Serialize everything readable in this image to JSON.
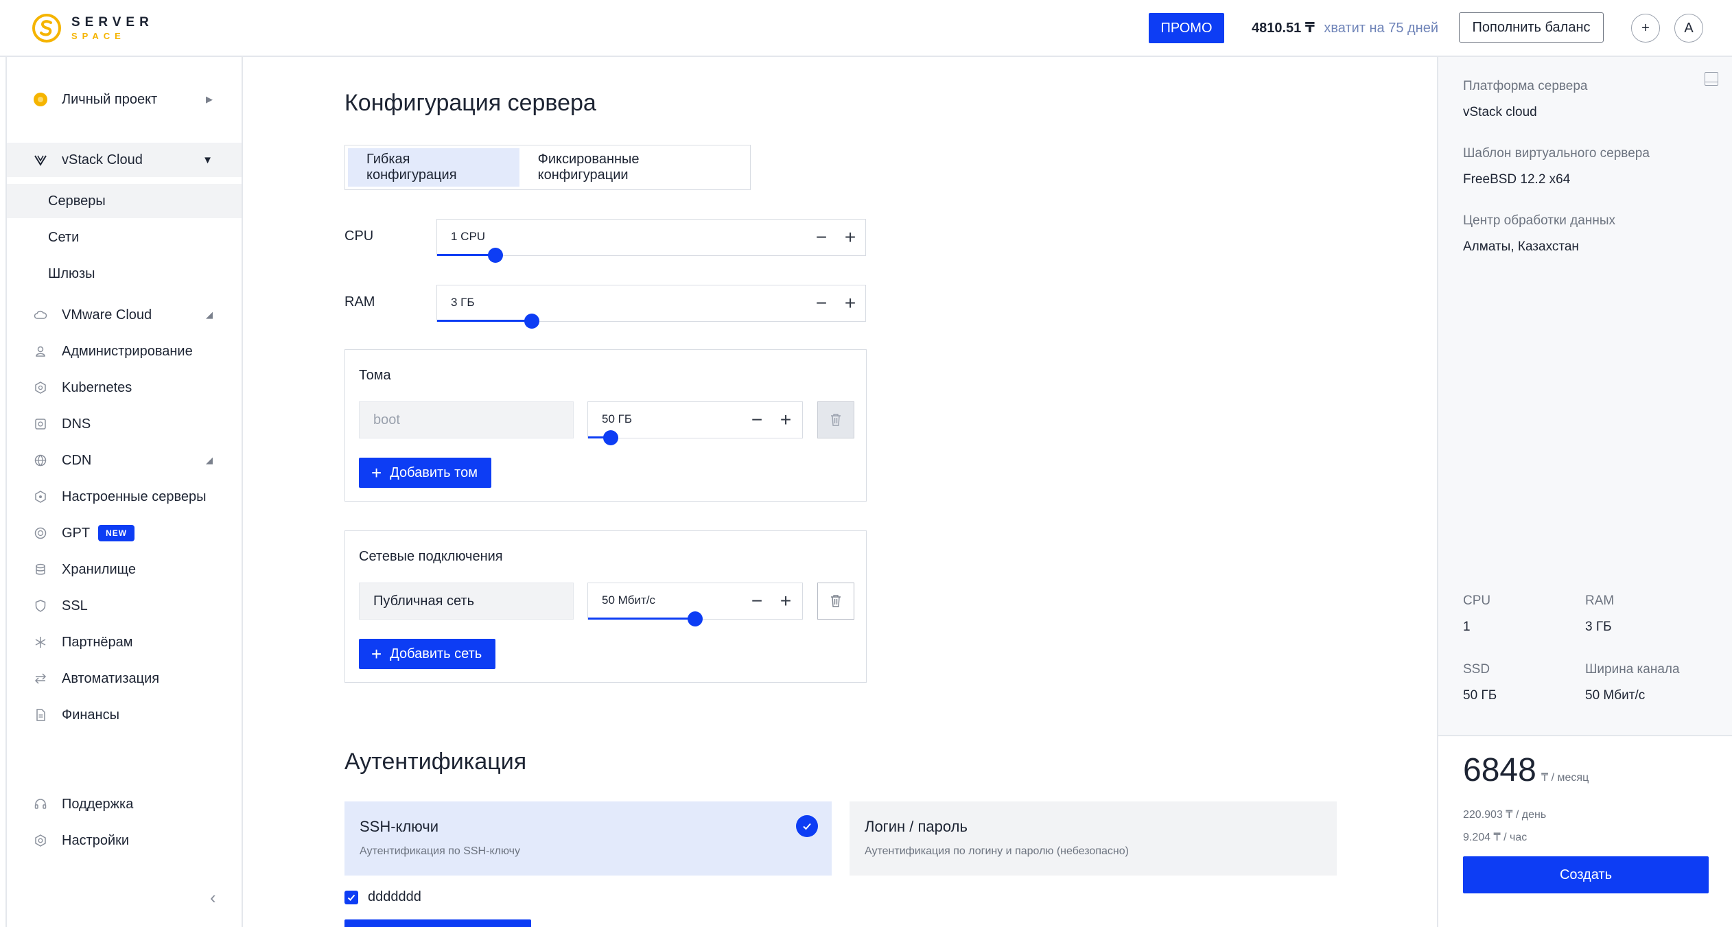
{
  "header": {
    "logo_line1": "SERVER",
    "logo_line2": "SPACE",
    "promo_label": "ПРОМО",
    "balance_amount": "4810.51 ₸",
    "balance_days": "хватит на 75 дней",
    "topup_label": "Пополнить баланс",
    "add_label": "+",
    "avatar_letter": "A"
  },
  "sidebar": {
    "project": "Личный проект",
    "section": "vStack Cloud",
    "sub_items": [
      "Серверы",
      "Сети",
      "Шлюзы"
    ],
    "items": [
      {
        "label": "VMware Cloud",
        "icon": "cloud-icon"
      },
      {
        "label": "Администрирование",
        "icon": "user-icon"
      },
      {
        "label": "Kubernetes",
        "icon": "kubernetes-icon"
      },
      {
        "label": "DNS",
        "icon": "dns-icon"
      },
      {
        "label": "CDN",
        "icon": "globe-icon"
      },
      {
        "label": "Настроенные серверы",
        "icon": "hexagon-icon"
      },
      {
        "label": "GPT",
        "icon": "gpt-icon"
      },
      {
        "label": "Хранилище",
        "icon": "database-icon"
      },
      {
        "label": "SSL",
        "icon": "shield-icon"
      },
      {
        "label": "Партнёрам",
        "icon": "snowflake-icon"
      },
      {
        "label": "Автоматизация",
        "icon": "arrows-icon"
      },
      {
        "label": "Финансы",
        "icon": "document-icon"
      }
    ],
    "gpt_badge": "NEW",
    "support": "Поддержка",
    "settings": "Настройки"
  },
  "main": {
    "title": "Конфигурация сервера",
    "tabs": [
      "Гибкая конфигурация",
      "Фиксированные конфигурации"
    ],
    "cpu": {
      "label": "CPU",
      "value": "1 CPU",
      "level": 0.137
    },
    "ram": {
      "label": "RAM",
      "value": "3 ГБ",
      "level": 0.221
    },
    "volumes": {
      "title": "Тома",
      "name": "boot",
      "size": "50 ГБ",
      "level": 0.105,
      "add_label": "Добавить том"
    },
    "network": {
      "title": "Сетевые подключения",
      "name": "Публичная сеть",
      "speed": "50 Мбит/с",
      "level": 0.5,
      "add_label": "Добавить сеть"
    },
    "auth": {
      "title": "Аутентификация",
      "ssh_title": "SSH-ключи",
      "ssh_desc": "Аутентификация по SSH-ключу",
      "login_title": "Логин / пароль",
      "login_desc": "Аутентификация по логину и паролю (небезопасно)",
      "key_name": "ddddddd"
    }
  },
  "summary": {
    "platform_label": "Платформа сервера",
    "platform_value": "vStack cloud",
    "template_label": "Шаблон виртуального сервера",
    "template_value": "FreeBSD 12.2 x64",
    "dc_label": "Центр обработки данных",
    "dc_value": "Алматы, Казахстан",
    "cpu_label": "CPU",
    "cpu_value": "1",
    "ram_label": "RAM",
    "ram_value": "3 ГБ",
    "ssd_label": "SSD",
    "ssd_value": "50 ГБ",
    "bw_label": "Ширина канала",
    "bw_value": "50 Мбит/с",
    "price": "6848",
    "price_unit": "₸ / месяц",
    "price_day": "220.903 ₸ / день",
    "price_hour": "9.204 ₸ / час",
    "create_label": "Создать"
  },
  "colors": {
    "accent": "#0d3df4",
    "logo": "#f5b400"
  }
}
